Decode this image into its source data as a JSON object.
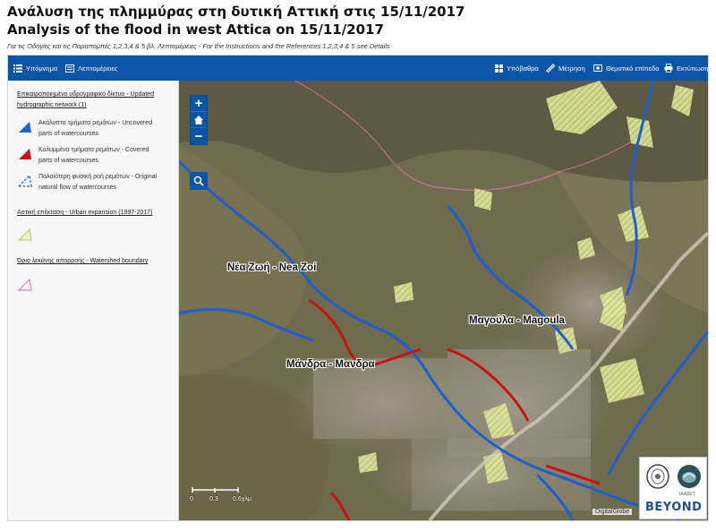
{
  "header": {
    "title_gr": "Ανάλυση της πλημμύρας στη δυτική Αττική στις 15/11/2017",
    "title_en": "Analysis of the flood in west Attica on 15/11/2017",
    "subtitle": "Για τις Οδηγίες και τις Παραπομπές 1,2,3,4 & 5 βλ. Λεπτομέρειες - For the Instructions and the References 1,2,3,4 & 5 see Details"
  },
  "toolbar": {
    "legend_label": "Υπόμνημα",
    "details_label": "Λεπτομέρειες",
    "basemap_label": "Υπόβαθρα",
    "measure_label": "Μέτρηση",
    "thematic_label": "Θεματικό επίπεδο",
    "print_label": "Εκτύπωση"
  },
  "legend": {
    "hydro_title": "Επικαιροποιημένο υδρογραφικό δίκτυο - Updated hydrographic network (1)",
    "items": [
      {
        "label": "Ακάλυπτα τμήματα ρεμάτων - Uncovered parts of watercourses",
        "color": "#1565d8"
      },
      {
        "label": "Καλυμμένα τμήματα ρεμάτων - Covered parts of watercourses",
        "color": "#cc1111"
      },
      {
        "label": "Παλαιότερη φυσική ροή ρεμάτων - Original natural flow of watercourses",
        "color": "#2a6fd6"
      }
    ],
    "urban_title": "Αστική επέκταση - Urban expansion (1997-2017)",
    "urban_color": "#e8f0a8",
    "watershed_title": "Όριο λεκάνης απορροής - Watershed boundary",
    "watershed_color": "#e080b8"
  },
  "map": {
    "labels": {
      "nea_zoi": "Νέα Ζωή - Nea Zoi",
      "magoula": "Μαγούλα - Magoula",
      "mandra": "Μάνδρα - Μανδρα"
    },
    "zoom_in": "+",
    "zoom_out": "−",
    "scale": {
      "t0": "0",
      "t1": "0.3",
      "t2": "0.6χλμ"
    },
    "attribution": "DigitalGlobe",
    "logo_text": "BEYOND",
    "logo_sub": "ΙΑΑΔΕΤ"
  }
}
